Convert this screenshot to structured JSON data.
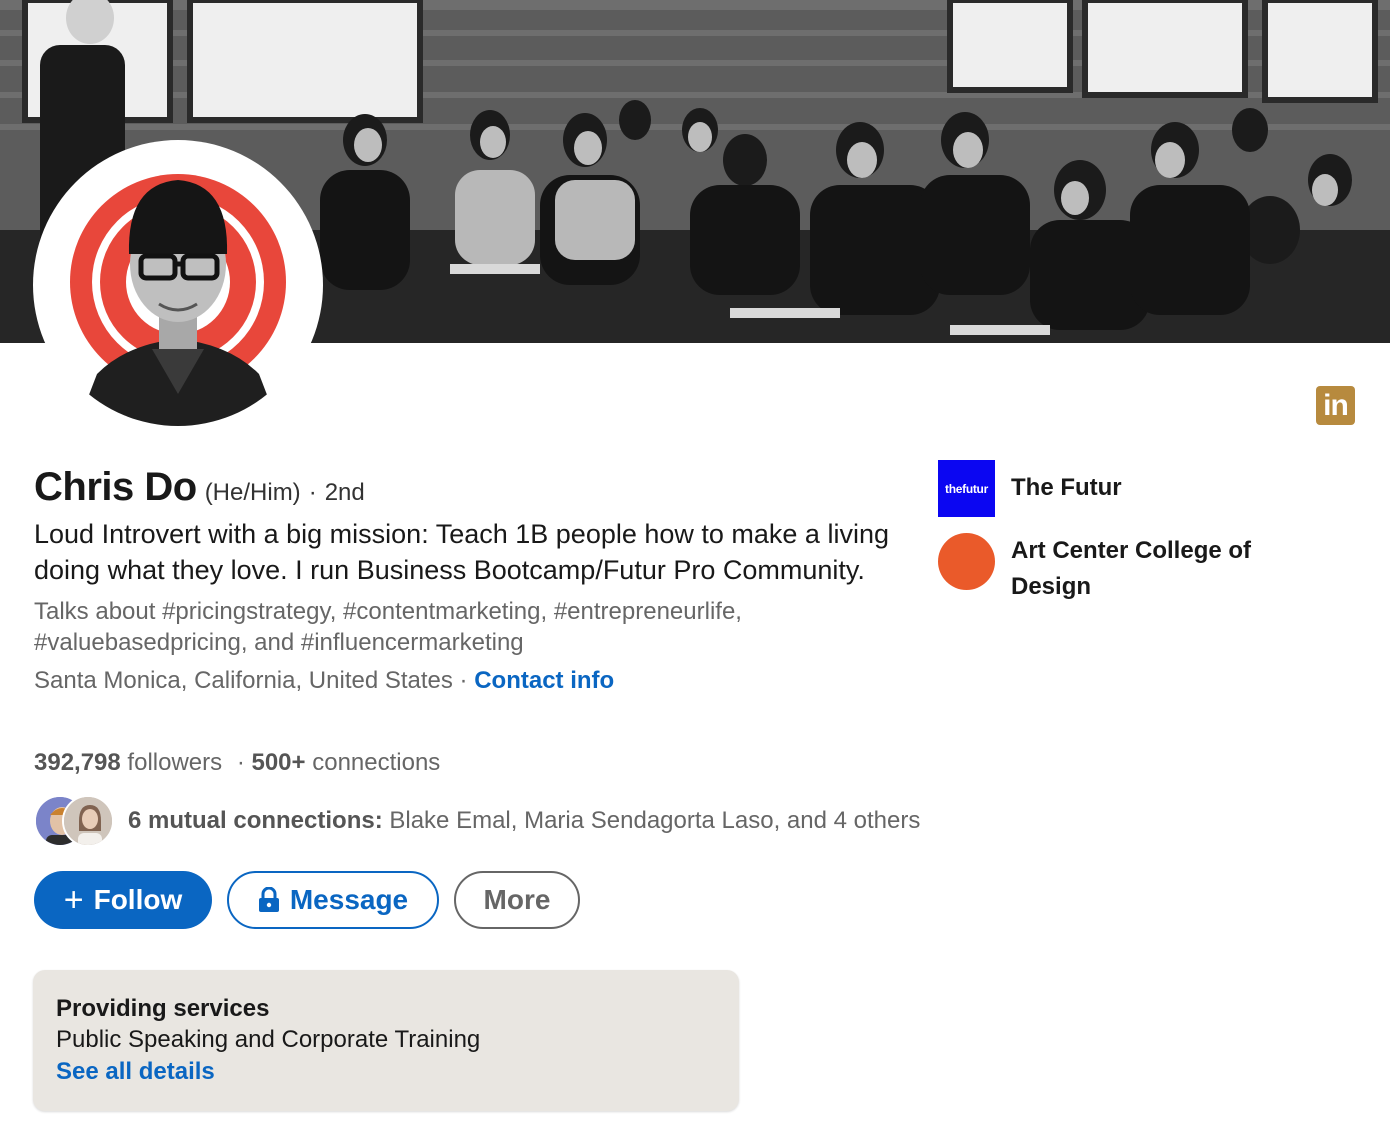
{
  "profile": {
    "name": "Chris Do",
    "pronouns": "(He/Him)",
    "degree_sep": "·",
    "degree": "2nd",
    "headline": "Loud Introvert with a big mission: Teach 1B people how to make a living doing what they love. I run Business Bootcamp/Futur Pro Community.",
    "talks_about": "Talks about #pricingstrategy, #contentmarketing, #entrepreneurlife, #valuebasedpricing, and #influencermarketing",
    "location": "Santa Monica, California, United States",
    "location_sep": " · ",
    "contact_info": "Contact info",
    "followers_count": "392,798",
    "followers_label": " followers",
    "stats_sep": " · ",
    "connections_count": "500+",
    "connections_label": " connections",
    "mutual_count_label": "6 mutual connections:",
    "mutual_names": " Blake Emal, Maria Sendagorta Laso, and 4 others"
  },
  "actions": {
    "follow_plus": "+",
    "follow_label": "Follow",
    "message_label": "Message",
    "more_label": "More"
  },
  "services": {
    "title": "Providing services",
    "subtitle": "Public Speaking and Corporate Training",
    "link": "See all details"
  },
  "companies": [
    {
      "name": "The Futur",
      "logo_text": "thefutur",
      "logo_color": "#0b06f2"
    },
    {
      "name": "Art Center College of Design",
      "logo_color": "#ea5a2a"
    }
  ],
  "badge": {
    "text": "in",
    "color": "#b78a3e"
  },
  "colors": {
    "accent": "#0a66c2",
    "muted_text": "#666666",
    "services_bg": "#e9e6e1"
  },
  "icons": {
    "lock": "lock-icon",
    "plus": "plus-icon"
  }
}
